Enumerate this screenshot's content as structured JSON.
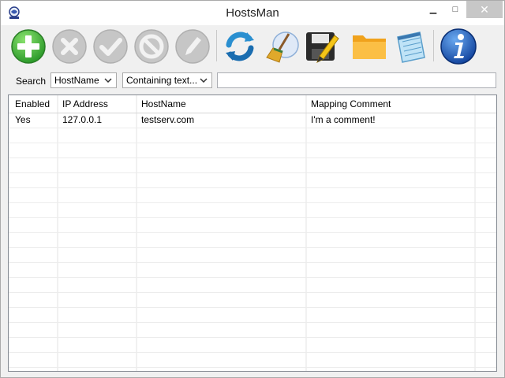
{
  "window": {
    "title": "HostsMan",
    "minimize_glyph": "▁",
    "maximize_glyph": "□",
    "close_glyph": "✕"
  },
  "toolbar": {
    "buttons": [
      {
        "name": "add-button",
        "icon": "plus-circle-icon",
        "enabled": true
      },
      {
        "name": "remove-button",
        "icon": "x-circle-icon",
        "enabled": false
      },
      {
        "name": "enable-button",
        "icon": "check-circle-icon",
        "enabled": false
      },
      {
        "name": "disable-button",
        "icon": "no-circle-icon",
        "enabled": false
      },
      {
        "name": "edit-button",
        "icon": "pencil-circle-icon",
        "enabled": false
      },
      {
        "name": "refresh-button",
        "icon": "refresh-icon",
        "enabled": true
      },
      {
        "name": "clean-button",
        "icon": "broom-icon",
        "enabled": true
      },
      {
        "name": "save-button",
        "icon": "floppy-pencil-icon",
        "enabled": true
      },
      {
        "name": "open-button",
        "icon": "folder-icon",
        "enabled": true
      },
      {
        "name": "notepad-button",
        "icon": "notepad-icon",
        "enabled": true
      },
      {
        "name": "about-button",
        "icon": "info-icon",
        "enabled": true
      }
    ],
    "colors": {
      "green": "#3fae3a",
      "disabled": "#bdbdbd",
      "blue": "#1565c0",
      "folder": "#f5a623"
    }
  },
  "search": {
    "label": "Search",
    "field_select": "HostName",
    "mode_select": "Containing text...",
    "value": ""
  },
  "table": {
    "columns": [
      "Enabled",
      "IP Address",
      "HostName",
      "Mapping Comment"
    ],
    "rows": [
      [
        "Yes",
        "127.0.0.1",
        "testserv.com",
        "I'm a comment!"
      ]
    ]
  }
}
